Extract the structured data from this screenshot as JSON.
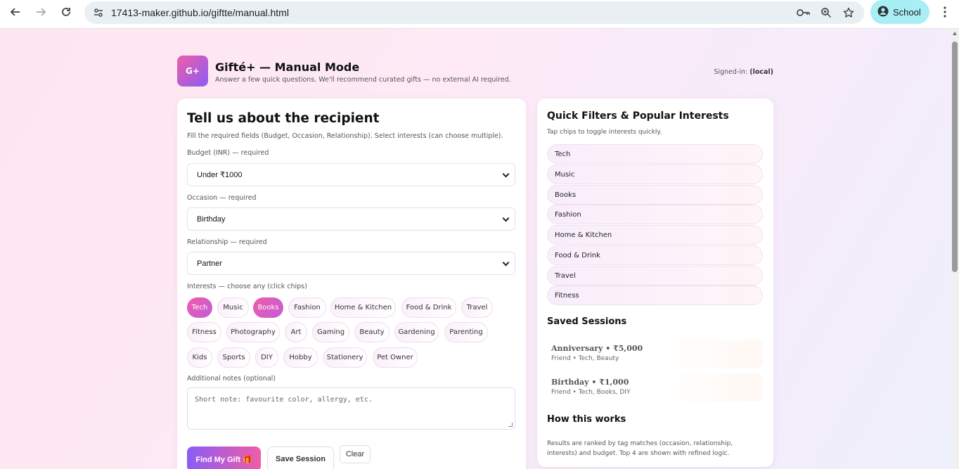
{
  "browser": {
    "url": "17413-maker.github.io/giftte/manual.html",
    "profile": "School",
    "icons": [
      "back-icon",
      "forward-icon",
      "reload-icon",
      "site-settings-icon",
      "key-icon",
      "zoom-icon",
      "star-icon",
      "menu-icon"
    ]
  },
  "header": {
    "logo": "G+",
    "title": "Gifté+ — Manual Mode",
    "subtitle": "Answer a few quick questions. We'll recommend curated gifts — no external AI required.",
    "signed_label": "Signed-in:",
    "signed_value": "(local)"
  },
  "form": {
    "title": "Tell us about the recipient",
    "description": "Fill the required fields (Budget, Occasion, Relationship). Select interests (can choose multiple).",
    "budget_label": "Budget (INR) — required",
    "budget_value": "Under ₹1000",
    "occasion_label": "Occasion — required",
    "occasion_value": "Birthday",
    "relationship_label": "Relationship — required",
    "relationship_value": "Partner",
    "interests_label": "Interests — choose any (click chips)",
    "interests": [
      {
        "label": "Tech",
        "selected": true
      },
      {
        "label": "Music",
        "selected": false
      },
      {
        "label": "Books",
        "selected": true
      },
      {
        "label": "Fashion",
        "selected": false
      },
      {
        "label": "Home & Kitchen",
        "selected": false
      },
      {
        "label": "Food & Drink",
        "selected": false
      },
      {
        "label": "Travel",
        "selected": false
      },
      {
        "label": "Fitness",
        "selected": false
      },
      {
        "label": "Photography",
        "selected": false
      },
      {
        "label": "Art",
        "selected": false
      },
      {
        "label": "Gaming",
        "selected": false
      },
      {
        "label": "Beauty",
        "selected": false
      },
      {
        "label": "Gardening",
        "selected": false
      },
      {
        "label": "Parenting",
        "selected": false
      },
      {
        "label": "Kids",
        "selected": false
      },
      {
        "label": "Sports",
        "selected": false
      },
      {
        "label": "DIY",
        "selected": false
      },
      {
        "label": "Hobby",
        "selected": false
      },
      {
        "label": "Stationery",
        "selected": false
      },
      {
        "label": "Pet Owner",
        "selected": false
      }
    ],
    "notes_label": "Additional notes (optional)",
    "notes_placeholder": "Short note: favourite color, allergy, etc.",
    "find_button": "Find My Gift 🎁",
    "save_button": "Save Session",
    "clear_button": "Clear"
  },
  "sidebar": {
    "filters_title": "Quick Filters & Popular Interests",
    "filters_desc": "Tap chips to toggle interests quickly.",
    "filters": [
      "Tech",
      "Music",
      "Books",
      "Fashion",
      "Home & Kitchen",
      "Food & Drink",
      "Travel",
      "Fitness"
    ],
    "sessions_title": "Saved Sessions",
    "sessions": [
      {
        "title": "Anniversary • ₹5,000",
        "sub": "Friend • Tech, Beauty"
      },
      {
        "title": "Birthday • ₹1,000",
        "sub": "Friend • Tech, Books, DIY"
      }
    ],
    "how_title": "How this works",
    "how_text": "Results are ranked by tag matches (occasion, relationship, interests) and budget. Top 4 are shown with refined logic."
  },
  "colors": {
    "accent_pink": "#ef5da8",
    "accent_purple": "#8b5cf6",
    "profile_pill": "#a8eef5"
  }
}
